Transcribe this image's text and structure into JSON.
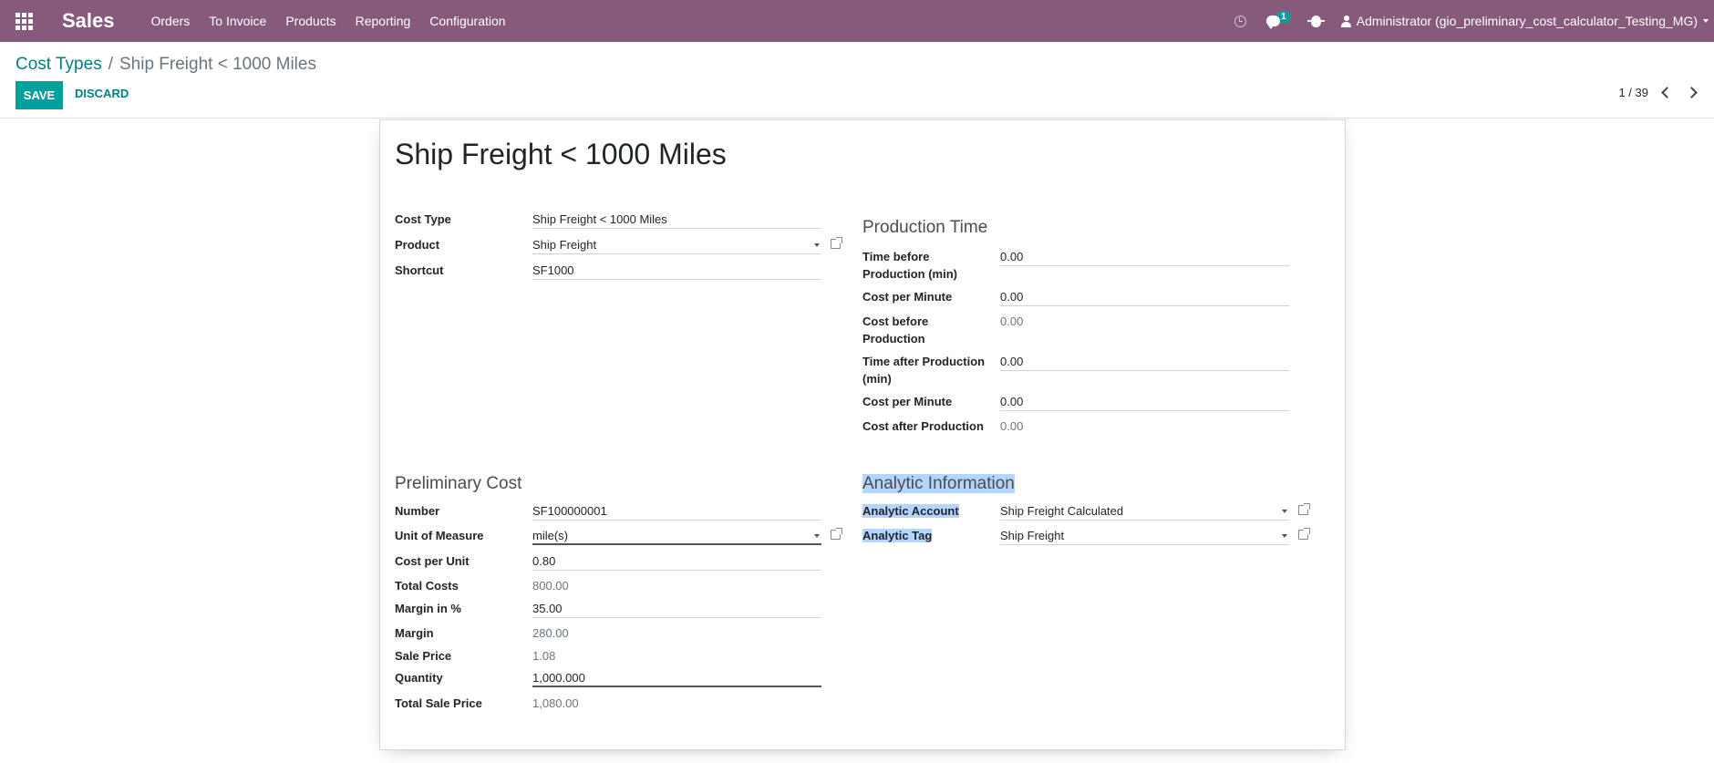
{
  "navbar": {
    "app_name": "Sales",
    "menu": [
      "Orders",
      "To Invoice",
      "Products",
      "Reporting",
      "Configuration"
    ],
    "chat_count": "1",
    "user": "Administrator (gio_preliminary_cost_calculator_Testing_MG)",
    "colors": {
      "bar": "#875a7b",
      "badge": "#00a09d"
    }
  },
  "control_panel": {
    "breadcrumb_parent": "Cost Types",
    "breadcrumb_separator": "/",
    "breadcrumb_current": "Ship Freight < 1000 Miles",
    "save_label": "SAVE",
    "discard_label": "DISCARD",
    "pager": "1 / 39"
  },
  "form": {
    "title": "Ship Freight < 1000 Miles",
    "general": {
      "cost_type": {
        "label": "Cost Type",
        "value": "Ship Freight < 1000 Miles"
      },
      "product": {
        "label": "Product",
        "value": "Ship Freight"
      },
      "shortcut": {
        "label": "Shortcut",
        "value": "SF1000"
      }
    },
    "production_time": {
      "title": "Production Time",
      "time_before": {
        "label": "Time before Production (min)",
        "value": "0.00"
      },
      "cost_per_minute_1": {
        "label": "Cost per Minute",
        "value": "0.00"
      },
      "cost_before": {
        "label": "Cost before Production",
        "value": "0.00"
      },
      "time_after": {
        "label": "Time after Production (min)",
        "value": "0.00"
      },
      "cost_per_minute_2": {
        "label": "Cost per Minute",
        "value": "0.00"
      },
      "cost_after": {
        "label": "Cost after Production",
        "value": "0.00"
      }
    },
    "preliminary_cost": {
      "title": "Preliminary Cost",
      "number": {
        "label": "Number",
        "value": "SF100000001"
      },
      "uom": {
        "label": "Unit of Measure",
        "value": "mile(s)"
      },
      "cost_per_unit": {
        "label": "Cost per Unit",
        "value": "0.80"
      },
      "total_costs": {
        "label": "Total Costs",
        "value": "800.00"
      },
      "margin_pct": {
        "label": "Margin in %",
        "value": "35.00"
      },
      "margin": {
        "label": "Margin",
        "value": "280.00"
      },
      "sale_price": {
        "label": "Sale Price",
        "value": "1.08"
      },
      "quantity": {
        "label": "Quantity",
        "value": "1,000.000"
      },
      "total_sale_price": {
        "label": "Total Sale Price",
        "value": "1,080.00"
      }
    },
    "analytic": {
      "title": "Analytic Information",
      "account": {
        "label": "Analytic Account",
        "value": "Ship Freight Calculated"
      },
      "tag": {
        "label": "Analytic Tag",
        "value": "Ship Freight"
      }
    }
  }
}
